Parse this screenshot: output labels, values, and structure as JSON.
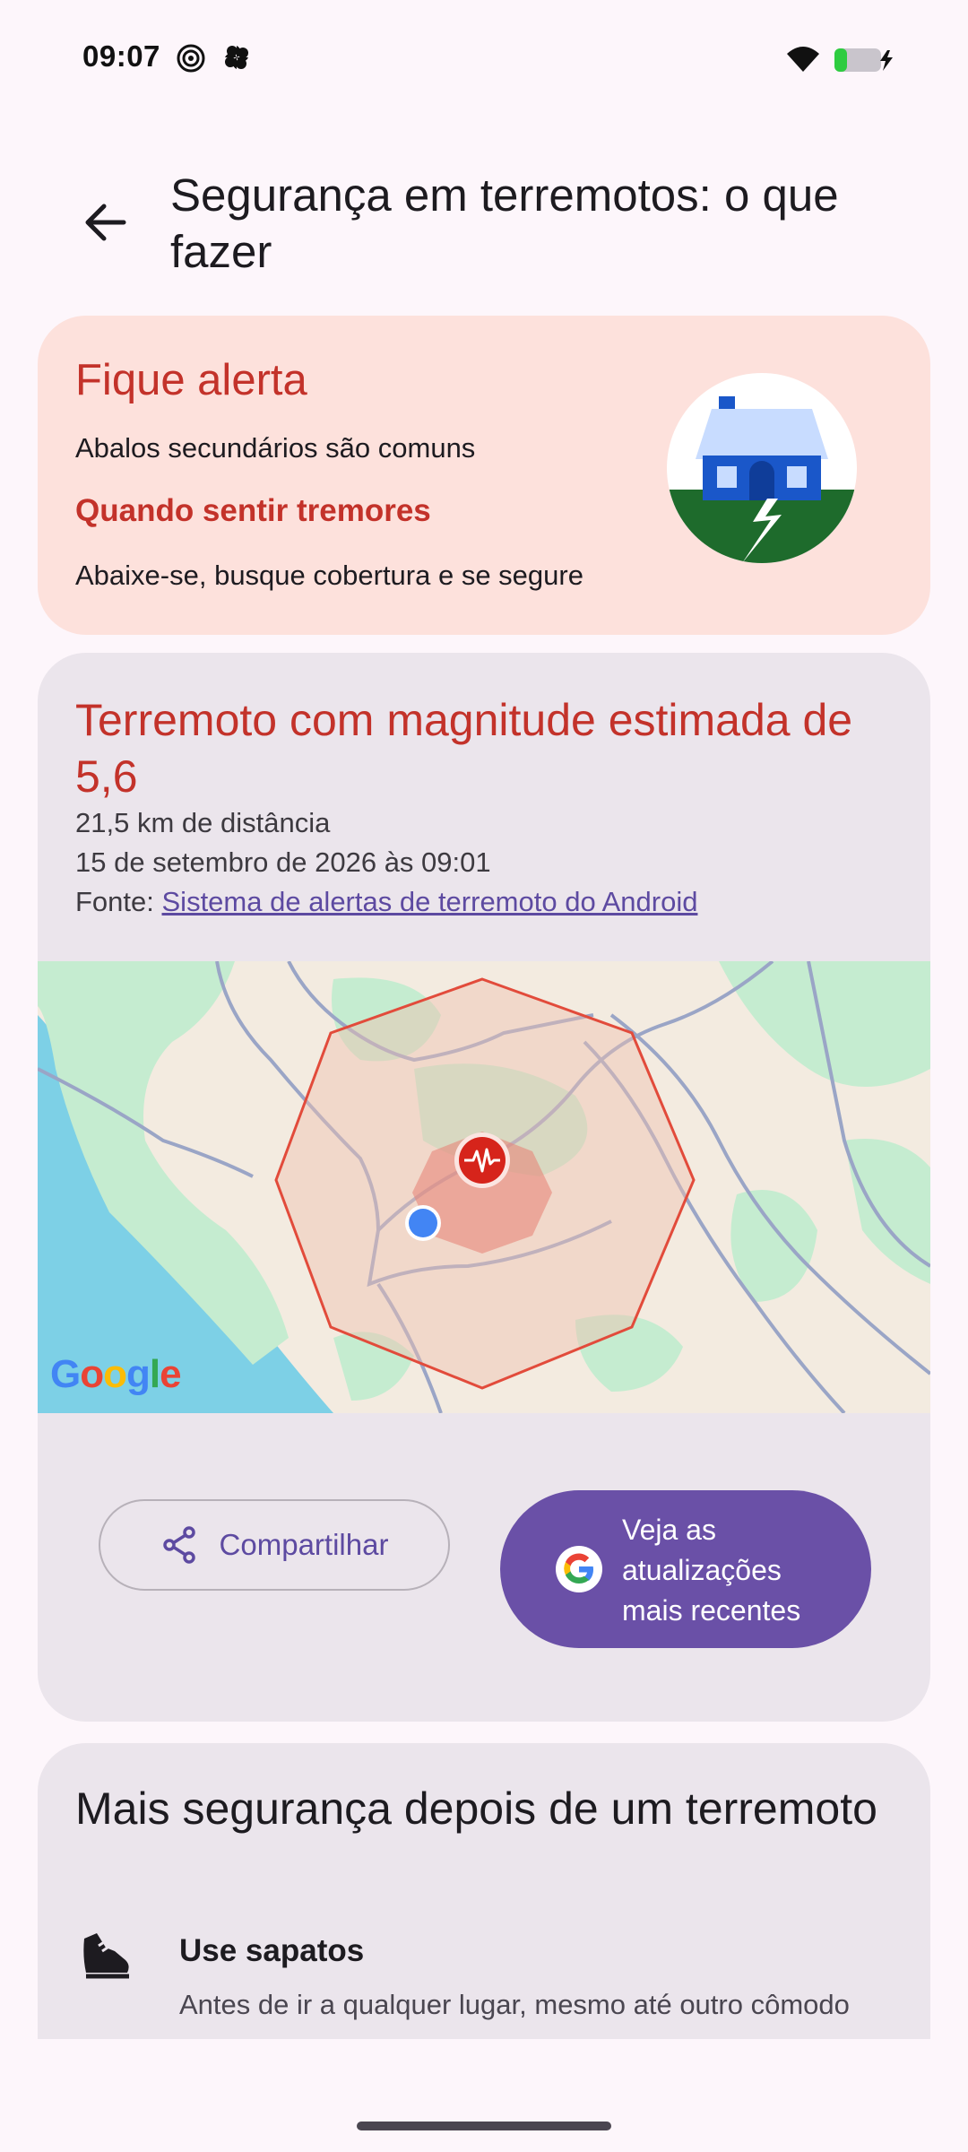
{
  "status_bar": {
    "time": "09:07",
    "left_icons": [
      "hotspot-icon",
      "pinwheel-icon"
    ],
    "right_icons": [
      "wifi-icon",
      "battery-charging-icon"
    ]
  },
  "app_bar": {
    "back_icon": "arrow-back-icon",
    "title": "Segurança em terremotos: o que fazer"
  },
  "alert_card": {
    "title": "Fique alerta",
    "subtitle": "Abalos secundários são comuns",
    "heading": "Quando sentir tremores",
    "action": "Abaixe-se, busque cobertura e se segure",
    "illustration": "house-earthquake-icon"
  },
  "quake_card": {
    "title": "Terremoto com magnitude estimada de 5,6",
    "distance": "21,5 km de distância",
    "datetime": "15 de setembro de 2026 às 09:01",
    "source_label": "Fonte: ",
    "source_link": "Sistema de alertas de terremoto do Android",
    "map_logo": "Google",
    "share_button": "Compartilhar",
    "updates_button": "Veja as atualizações mais recentes",
    "colors": {
      "alert_red": "#c3322a",
      "button_purple": "#6a50a7",
      "user_dot": "#4285f4"
    }
  },
  "more_card": {
    "title": "Mais segurança depois de um terremoto",
    "tip_icon": "shoe-icon",
    "tip_title": "Use sapatos",
    "tip_desc": "Antes de ir a qualquer lugar, mesmo até outro cômodo"
  }
}
